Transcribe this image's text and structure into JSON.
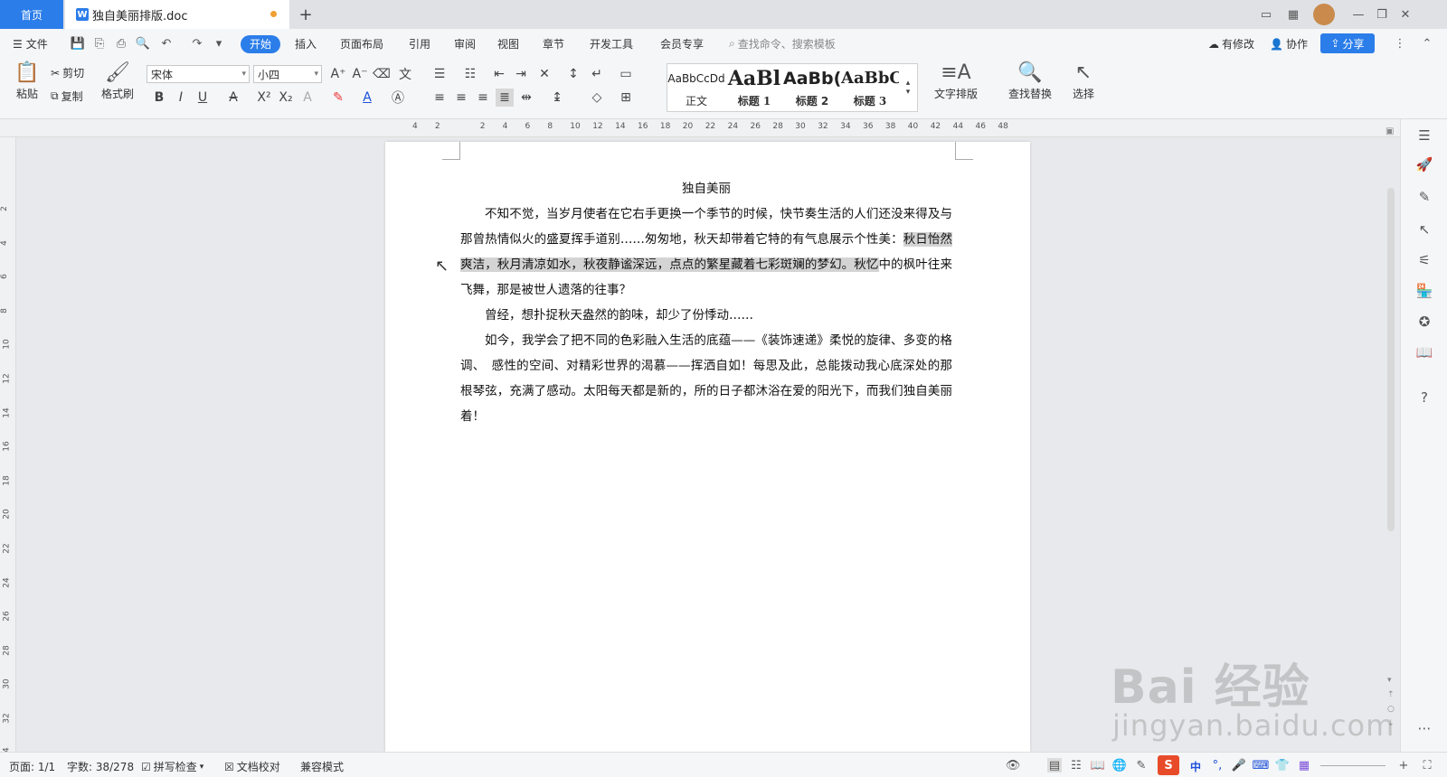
{
  "tabs": {
    "home": "首页",
    "document": "独自美丽排版.doc",
    "new_tab": "+"
  },
  "menu": {
    "file": "文件",
    "items": [
      "开始",
      "插入",
      "页面布局",
      "引用",
      "审阅",
      "视图",
      "章节",
      "开发工具",
      "会员专享"
    ],
    "search_placeholder": "查找命令、搜索模板",
    "modified": "有修改",
    "collaborate": "协作",
    "share": "分享"
  },
  "ribbon": {
    "paste": "粘贴",
    "cut": "剪切",
    "copy": "复制",
    "format_painter": "格式刷",
    "font_name": "宋体",
    "font_size": "小四",
    "styles": [
      {
        "sample": "AaBbCcDd",
        "label": "正文"
      },
      {
        "sample": "AaBl",
        "label": "标题 1"
      },
      {
        "sample": "AaBb(",
        "label": "标题 2"
      },
      {
        "sample": "AaBbC",
        "label": "标题 3"
      }
    ],
    "text_layout": "文字排版",
    "find_replace": "查找替换",
    "select": "选择"
  },
  "ruler": {
    "h_ticks": [
      "4",
      "2",
      "",
      "2",
      "4",
      "6",
      "8",
      "10",
      "12",
      "14",
      "16",
      "18",
      "20",
      "22",
      "24",
      "26",
      "28",
      "30",
      "32",
      "34",
      "36",
      "38",
      "40",
      "42",
      "44",
      "46",
      "48"
    ],
    "v_ticks": [
      "2",
      "4",
      "6",
      "8",
      "10",
      "12",
      "14",
      "16",
      "18",
      "20",
      "22",
      "24",
      "26",
      "28",
      "30",
      "32",
      "34"
    ]
  },
  "document": {
    "title": "独自美丽",
    "p1_a": "不知不觉，当岁月使者在它右手更换一个季节的时候，快节奏生活的人们还没来得及与那曾热情似火的盛夏挥手道别……匆匆地，秋天却带着它特的有气息展示个性美：",
    "p1_selected": "秋日怡然爽洁，秋月清凉如水，秋夜静谧深远，点点的繁星藏着七彩斑斓的梦幻。秋忆",
    "p1_b": "中的枫叶往来飞舞，那是被世人遗落的往事？",
    "p2": "曾经，想扑捉秋天盎然的韵味，却少了份悸动……",
    "p3": "如今，我学会了把不同的色彩融入生活的底蕴——《装饰速递》柔悦的旋律、多变的格调、　感性的空间、对精彩世界的渴慕——挥洒自如！每思及此，总能拨动我心底深处的那根琴弦，充满了感动。太阳每天都是新的，所的日子都沐浴在爱的阳光下，而我们独自美丽着！"
  },
  "status": {
    "page": "页面: 1/1",
    "words": "字数: 38/278",
    "spell_check": "拼写检查",
    "doc_proof": "文档校对",
    "compat_mode": "兼容模式"
  },
  "ime": {
    "lang": "中"
  },
  "watermark": {
    "logo": "Bai 经验",
    "url": "jingyan.baidu.com"
  },
  "colors": {
    "accent": "#2b7de9",
    "selection": "#d4d4d4"
  }
}
